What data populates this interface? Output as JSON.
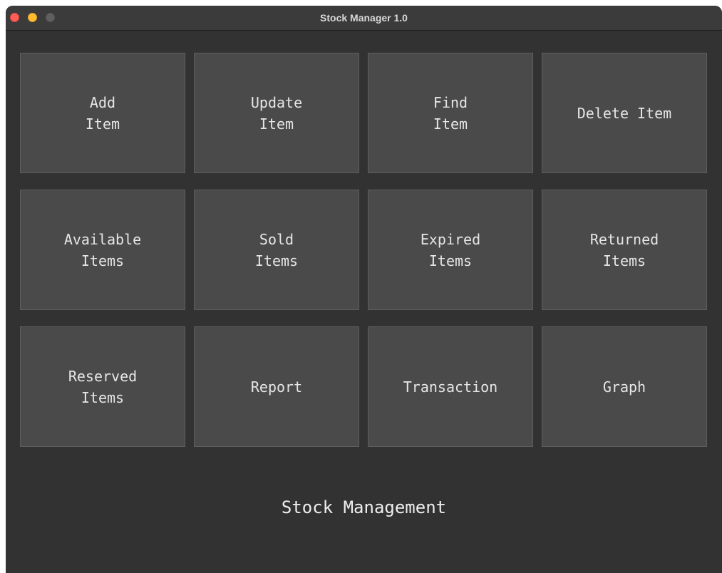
{
  "window": {
    "title": "Stock Manager 1.0"
  },
  "tiles": [
    {
      "label": "Add\nItem"
    },
    {
      "label": "Update\nItem"
    },
    {
      "label": "Find\nItem"
    },
    {
      "label": "Delete Item"
    },
    {
      "label": "Available\nItems"
    },
    {
      "label": "Sold\nItems"
    },
    {
      "label": "Expired\n Items"
    },
    {
      "label": "Returned\n Items"
    },
    {
      "label": "Reserved\n Items"
    },
    {
      "label": "Report"
    },
    {
      "label": "Transaction"
    },
    {
      "label": "Graph"
    }
  ],
  "footer": {
    "text": "Stock Management"
  },
  "colors": {
    "background": "#323232",
    "tile": "#4a4a4a",
    "close": "#ff5f57",
    "minimize": "#febc2e",
    "maximize_disabled": "#5f5f5f"
  }
}
